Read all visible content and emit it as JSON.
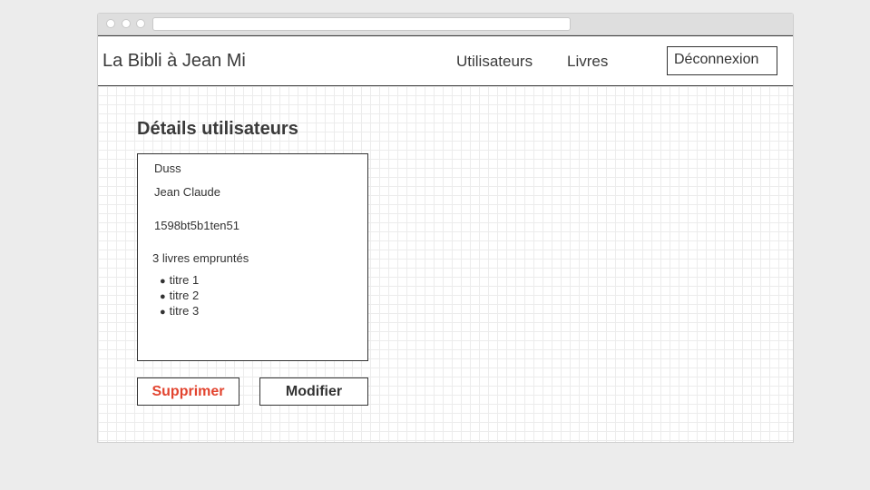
{
  "navbar": {
    "brand": "La Bibli à Jean Mi",
    "links": [
      {
        "label": "Utilisateurs"
      },
      {
        "label": "Livres"
      }
    ],
    "logout_label": "Déconnexion"
  },
  "page": {
    "title": "Détails utilisateurs"
  },
  "user": {
    "last_name": "Duss",
    "first_name": "Jean Claude",
    "id": "1598bt5b1ten51",
    "borrowed_summary": "3 livres empruntés",
    "books": [
      "titre 1",
      "titre 2",
      "titre 3"
    ]
  },
  "actions": {
    "delete_label": "Supprimer",
    "edit_label": "Modifier"
  },
  "colors": {
    "delete": "#e2442f",
    "text": "#333333"
  }
}
